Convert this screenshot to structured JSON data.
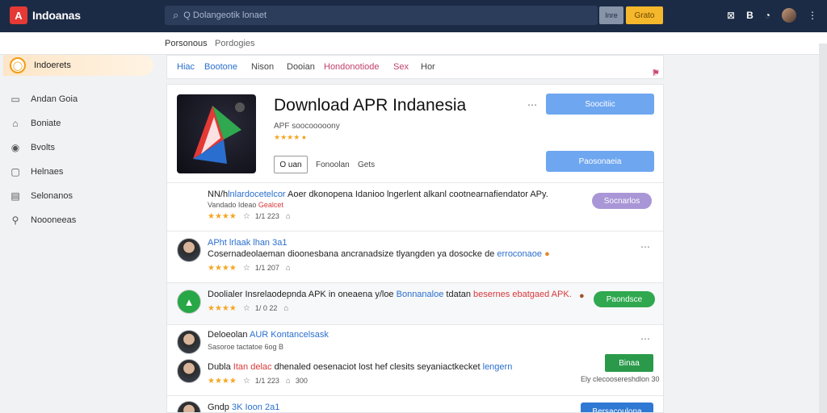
{
  "topbar": {
    "logo_mark": "A",
    "logo_text": "Indoanas",
    "search_placeholder": "Q Dolangeotik lonaet",
    "btn_grey": "Inre",
    "btn_yellow": "Grato",
    "icons": [
      "grid-icon",
      "bold-icon",
      "clock-icon"
    ]
  },
  "subbar": {
    "tab1": "Porsonous",
    "tab2": "Pordogies"
  },
  "sidebar": {
    "active": "Indoerets",
    "items": [
      {
        "label": "Andan Goia",
        "icon": "folder-icon"
      },
      {
        "label": "Boniate",
        "icon": "home-icon"
      },
      {
        "label": "Bvolts",
        "icon": "eye-icon"
      },
      {
        "label": "Helnaes",
        "icon": "square-icon"
      },
      {
        "label": "Selonanos",
        "icon": "document-icon"
      },
      {
        "label": "Noooneeas",
        "icon": "tag-icon"
      }
    ]
  },
  "filters": {
    "items": [
      "Hiac",
      "Bootone",
      "Nison",
      "Dooian",
      "Hondonotiode",
      "Sex",
      "Hor"
    ],
    "icons": [
      "heart-icon",
      "bookmark-icon",
      "share-icon"
    ]
  },
  "hero": {
    "title": "Download APR Indanesia",
    "subtitle": "APF soocooooony",
    "stars": "★★★★",
    "btn_outline": "O uan",
    "link1": "Fonoolan",
    "link2": "Gets",
    "btn1": "Soocitiic",
    "btn2": "Paosonaeia"
  },
  "rows": [
    {
      "title_a": "NN/h",
      "title_b": "lnlardocetelcor",
      "title_c": " Aoer dkonopena Idanioo lngerlent alkanl cootnearnafiendator APy.",
      "line2_a": "Vandado Ideao",
      "line2_b": "Gealcet",
      "rating": "★★★★",
      "count": "1/1 223",
      "btn": "Socnarlos"
    },
    {
      "title_a": "APht",
      "title_b": " lrlaak lhan 3a1",
      "title_c": "Cosernadeolaeman dioonesbana ancranadsize tlyangden ya dosocke de",
      "title_d": " erroconaoe",
      "rating": "★★★★",
      "count": "1/1 207"
    },
    {
      "title_a": "Doolialer Insrelaodepnda APK in oneaena y/loe",
      "title_b": " Bonnanaloe",
      "title_c": " tdatan",
      "title_d": " besernes ebatgaed APK.",
      "rating": "★★★★",
      "count": "1/ 0 22",
      "btn": "Paondsce"
    },
    {
      "title_a": "Deloeolan",
      "title_b": " AUR Kontancelsask",
      "meta": "Sasoroe tactatoe 6og  B",
      "line2_a": "Dubla",
      "line2_b": " Itan delac",
      "line2_c": " dhenaled oesenaciot lost hef clesits seyaniactkecket",
      "line2_d": " lengern",
      "rating": "★★★★",
      "count": "1/1 223",
      "count2": "300",
      "btn": "Binaa",
      "foot": "Ely clecoosereshdlon 30"
    },
    {
      "title_a": "Gndp",
      "title_b": " 3K Ioon 2a1",
      "btn": "Bersacoulona"
    }
  ]
}
